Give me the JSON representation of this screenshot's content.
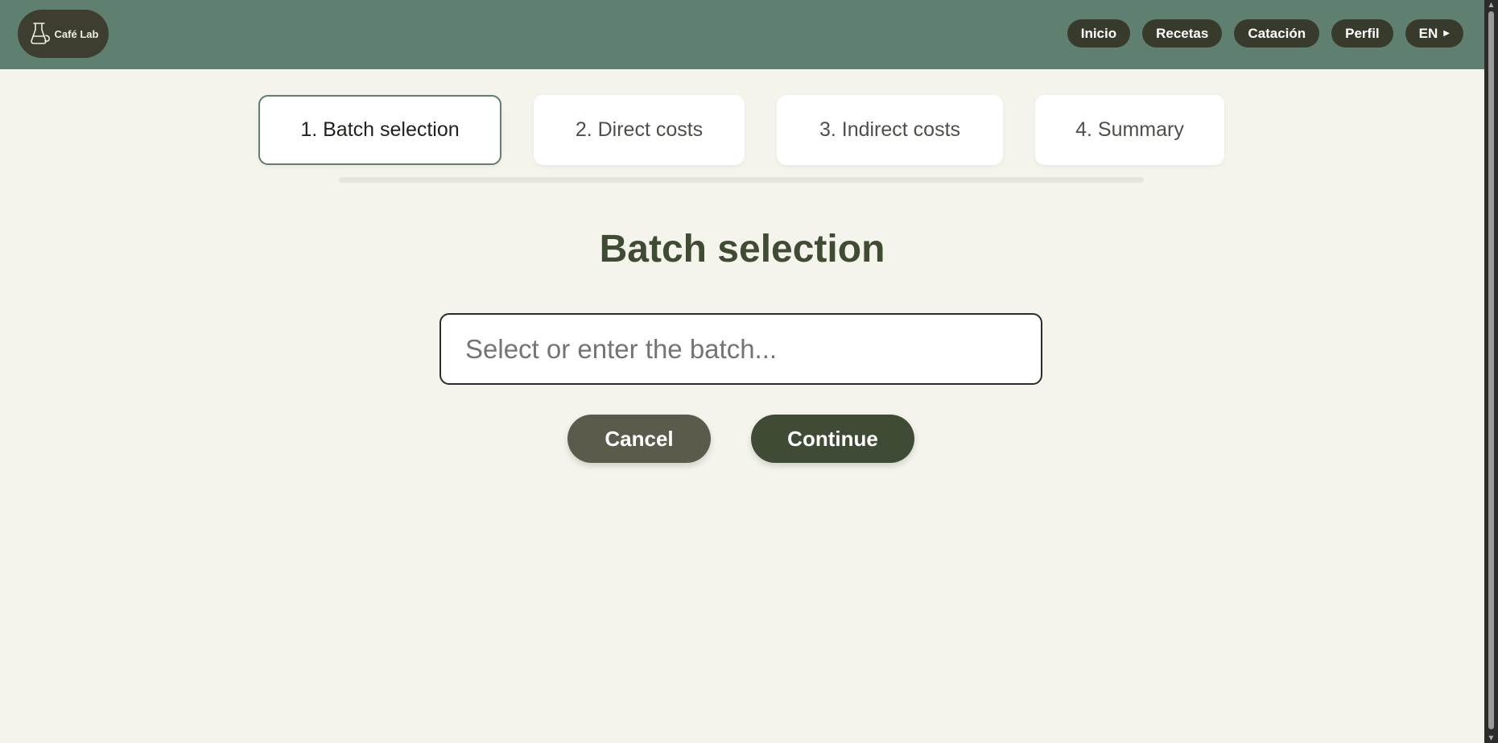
{
  "header": {
    "logo": {
      "text": "Café Lab",
      "icon": "coffee-dripper-icon"
    },
    "nav": [
      {
        "label": "Inicio"
      },
      {
        "label": "Recetas"
      },
      {
        "label": "Catación"
      },
      {
        "label": "Perfil"
      },
      {
        "label": "EN",
        "icon": "caret-right-icon"
      }
    ]
  },
  "stepper": {
    "steps": [
      {
        "label": "1. Batch selection",
        "active": true
      },
      {
        "label": "2. Direct costs",
        "active": false
      },
      {
        "label": "3. Indirect costs",
        "active": false
      },
      {
        "label": "4. Summary",
        "active": false
      }
    ]
  },
  "main": {
    "title": "Batch selection",
    "batch_input": {
      "value": "",
      "placeholder": "Select or enter the batch..."
    },
    "cancel_label": "Cancel",
    "continue_label": "Continue"
  },
  "colors": {
    "header_bg": "#5f7f70",
    "page_bg": "#f5f4ec",
    "nav_button_bg": "#383a2c",
    "title": "#404b33",
    "cancel_bg": "#5c5b4b",
    "continue_bg": "#404b35",
    "active_step_border": "#5e7e6e"
  }
}
